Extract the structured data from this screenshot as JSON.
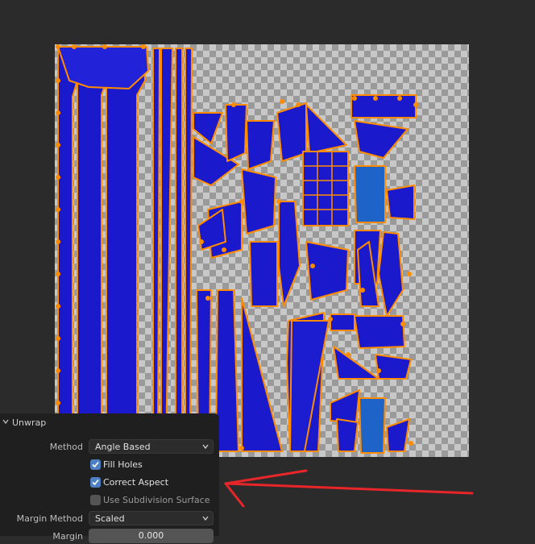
{
  "panel": {
    "title": "Unwrap",
    "method_label": "Method",
    "method_value": "Angle Based",
    "fill_holes": {
      "label": "Fill Holes",
      "checked": true
    },
    "correct_aspect": {
      "label": "Correct Aspect",
      "checked": true
    },
    "use_subdivision": {
      "label": "Use Subdivision Surface",
      "checked": false
    },
    "margin_method_label": "Margin Method",
    "margin_method_value": "Scaled",
    "margin_label": "Margin",
    "margin_value": "0.000"
  },
  "colors": {
    "island_fill": "#1a1acc",
    "island_edge": "#ff8c00",
    "annotation": "#e8262a",
    "checkbox_on": "#4d7fc2"
  }
}
